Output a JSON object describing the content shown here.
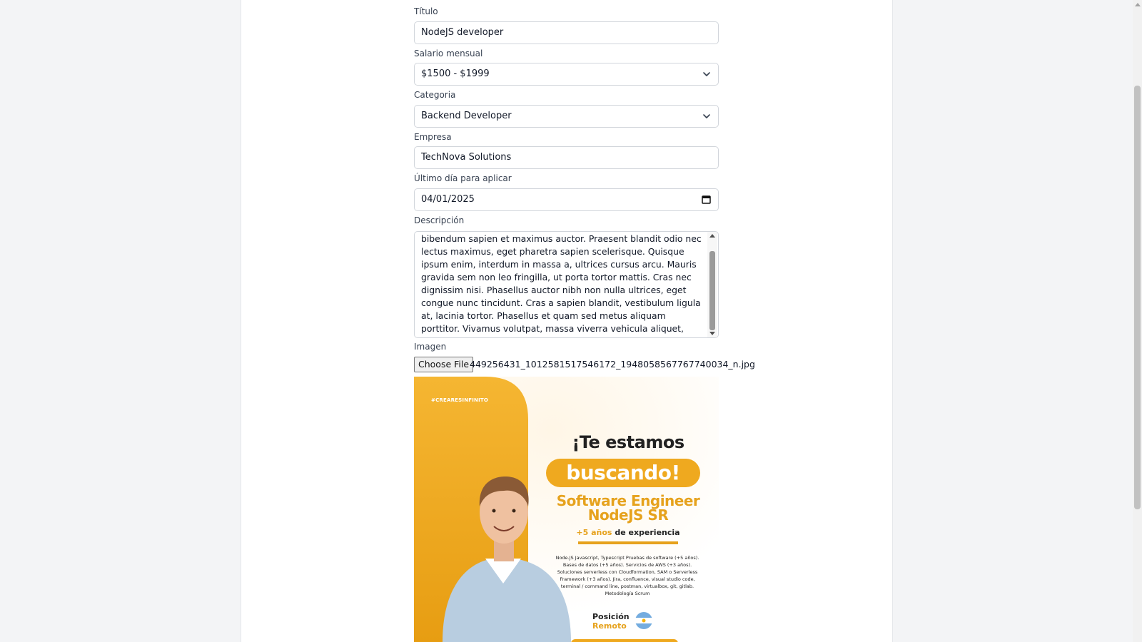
{
  "form": {
    "titulo": {
      "label": "Título",
      "value": "NodeJS developer"
    },
    "salario": {
      "label": "Salario mensual",
      "value": "$1500 - $1999"
    },
    "categoria": {
      "label": "Categoria",
      "value": "Backend Developer"
    },
    "empresa": {
      "label": "Empresa",
      "value": "TechNova Solutions"
    },
    "ultimo_dia": {
      "label": "Último día para aplicar",
      "value": "04/01/2025"
    },
    "descripcion": {
      "label": "Descripción",
      "value": "bibendum sapien et maximus auctor. Praesent blandit odio nec lectus maximus, eget pharetra sapien scelerisque. Quisque ipsum enim, interdum in massa a, ultrices cursus arcu. Mauris gravida sem non leo fringilla, ut porta tortor mattis. Cras nec dignissim nisi. Phasellus auctor nibh non nulla ultrices, eget congue nunc tincidunt. Cras a sapien blandit, vestibulum ligula at, lacinia tortor. Phasellus et quam sed metus aliquam porttitor. Vivamus volutpat, massa viverra vehicula aliquet, odio nisi dignissim ligula."
    },
    "imagen": {
      "label": "Imagen",
      "button": "Choose File",
      "filename": "449256431_1012581517546172_1948058567767740034_n.jpg"
    }
  },
  "poster": {
    "tag": "#CREARESINFINITO",
    "headline": "¡Te estamos",
    "headline_pill": "buscando!",
    "role_line1": "Software Engineer",
    "role_line2": "NodeJS SR",
    "exp_highlight": "+5 años",
    "exp_rest": " de experiencia",
    "skills": "Node.JS Javascript, Typescript Pruebas de software (+5 años). Bases de datos (+5 años). Servicios de AWS (+3 años). Soluciones serverless con Cloudformation, SAM o Serverless Framework (+3 años). Jira, confluence, visual studio code, terminal / command line, postman, virtualbox, git, gitlab. Metodología Scrum",
    "pos_label": "Posición",
    "pos_value": "Remoto",
    "accent_color": "#efa91f"
  },
  "icons": {
    "select_chevron": "chevron-down-icon",
    "date_picker": "calendar-icon"
  }
}
